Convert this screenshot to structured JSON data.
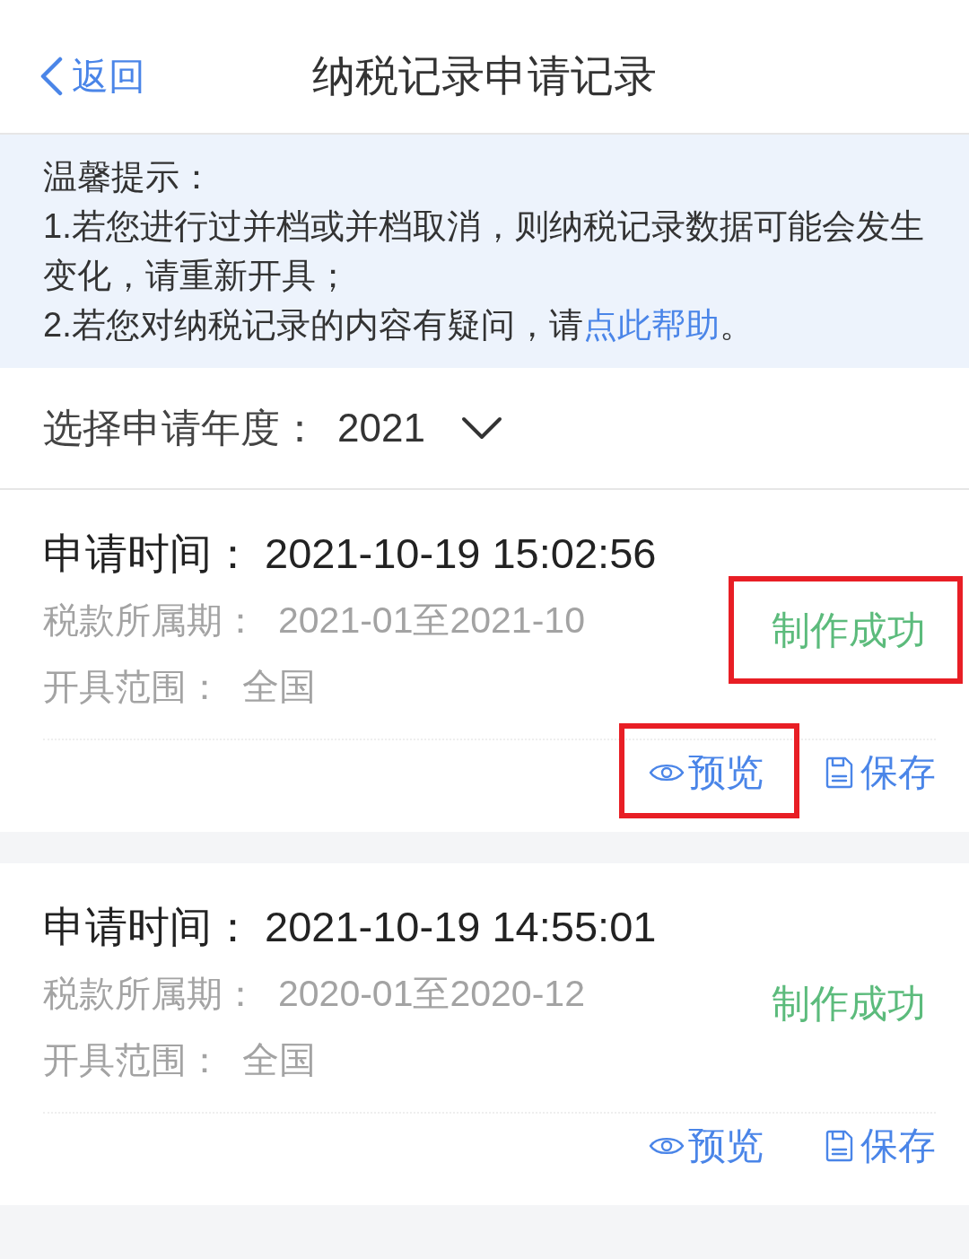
{
  "header": {
    "back": "返回",
    "title": "纳税记录申请记录"
  },
  "notice": {
    "title": "温馨提示：",
    "items": [
      {
        "text": "1.若您进行过并档或并档取消，则纳税记录数据可能会发生变化，请重新开具；"
      },
      {
        "text": "2.若您对纳税记录的内容有疑问，请",
        "link": "点此帮助",
        "after": "。"
      }
    ]
  },
  "year_filter": {
    "label": "选择申请年度：",
    "value": "2021"
  },
  "records": [
    {
      "time_label": "申请时间：",
      "time": "2021-10-19 15:02:56",
      "fields": [
        {
          "label": "税款所属期：",
          "value": "2021-01至2021-10"
        },
        {
          "label": "开具范围：",
          "value": "全国"
        }
      ],
      "status": {
        "text": "制作成功",
        "highlighted": true
      },
      "actions": [
        {
          "kind": "preview",
          "label": "预览",
          "highlighted": true
        },
        {
          "kind": "save",
          "label": "保存",
          "highlighted": false
        }
      ]
    },
    {
      "time_label": "申请时间：",
      "time": "2021-10-19 14:55:01",
      "fields": [
        {
          "label": "税款所属期：",
          "value": "2020-01至2020-12"
        },
        {
          "label": "开具范围：",
          "value": "全国"
        }
      ],
      "status": {
        "text": "制作成功",
        "highlighted": false
      },
      "actions": [
        {
          "kind": "preview",
          "label": "预览",
          "highlighted": false
        },
        {
          "kind": "save",
          "label": "保存",
          "highlighted": false
        }
      ]
    }
  ]
}
